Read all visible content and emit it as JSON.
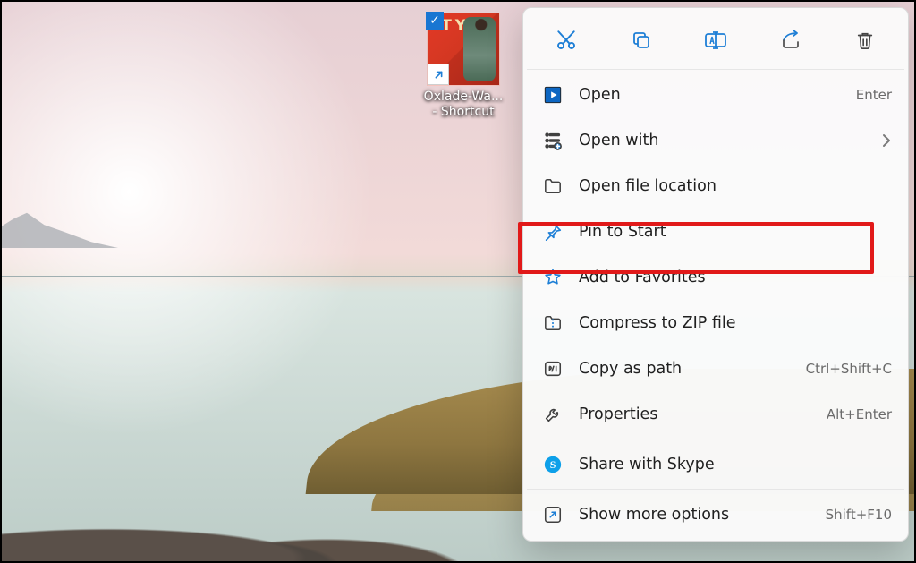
{
  "shortcut": {
    "thumb_text": "NT YOU",
    "line1": "Oxlade-Wa...",
    "line2": "- Shortcut"
  },
  "quick_actions": {
    "cut": "Cut",
    "copy": "Copy",
    "rename": "Rename",
    "share": "Share",
    "delete": "Delete"
  },
  "menu": {
    "open": {
      "label": "Open",
      "hint": "Enter"
    },
    "open_with": {
      "label": "Open with",
      "hint": ""
    },
    "open_location": {
      "label": "Open file location",
      "hint": ""
    },
    "pin_to_start": {
      "label": "Pin to Start",
      "hint": ""
    },
    "add_favorites": {
      "label": "Add to Favorites",
      "hint": ""
    },
    "compress_zip": {
      "label": "Compress to ZIP file",
      "hint": ""
    },
    "copy_as_path": {
      "label": "Copy as path",
      "hint": "Ctrl+Shift+C"
    },
    "properties": {
      "label": "Properties",
      "hint": "Alt+Enter"
    },
    "share_skype": {
      "label": "Share with Skype",
      "hint": ""
    },
    "show_more": {
      "label": "Show more options",
      "hint": "Shift+F10"
    }
  },
  "colors": {
    "accent": "#1e7fd6",
    "highlight": "#e11919"
  }
}
